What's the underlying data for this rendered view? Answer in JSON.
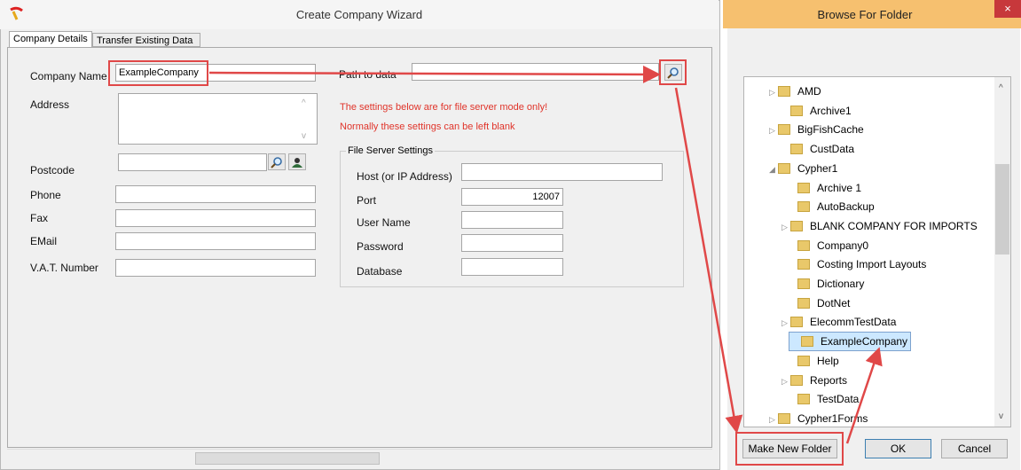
{
  "wizard": {
    "title": "Create Company Wizard",
    "tabs": [
      {
        "label": "Company Details",
        "active": true
      },
      {
        "label": "Transfer Existing Data",
        "active": false
      }
    ],
    "fields": {
      "company_name_label": "Company Name",
      "company_name_value": "ExampleCompany",
      "address_label": "Address",
      "postcode_label": "Postcode",
      "phone_label": "Phone",
      "fax_label": "Fax",
      "email_label": "EMail",
      "vat_label": "V.A.T. Number",
      "path_label": "Path to data"
    },
    "notes": {
      "line1": "The settings below are for file server mode only!",
      "line2": "Normally these settings can be left  blank"
    },
    "file_server": {
      "group_label": "File Server Settings",
      "host_label": "Host (or IP Address)",
      "port_label": "Port",
      "port_value": "12007",
      "user_label": "User Name",
      "password_label": "Password",
      "database_label": "Database"
    }
  },
  "browse": {
    "title": "Browse For Folder",
    "close_glyph": "×",
    "tree": [
      {
        "label": "AMD",
        "expander": "▷"
      },
      {
        "label": "Archive1",
        "expander": ""
      },
      {
        "label": "BigFishCache",
        "expander": "▷"
      },
      {
        "label": "CustData",
        "expander": ""
      },
      {
        "label": "Cypher1",
        "expander": "◢"
      },
      {
        "label": "Archive 1",
        "expander": ""
      },
      {
        "label": "AutoBackup",
        "expander": ""
      },
      {
        "label": "BLANK COMPANY FOR IMPORTS",
        "expander": "▷"
      },
      {
        "label": "Company0",
        "expander": ""
      },
      {
        "label": "Costing Import Layouts",
        "expander": ""
      },
      {
        "label": "Dictionary",
        "expander": ""
      },
      {
        "label": "DotNet",
        "expander": ""
      },
      {
        "label": "ElecommTestData",
        "expander": "▷"
      },
      {
        "label": "ExampleCompany",
        "expander": "",
        "selected": true
      },
      {
        "label": "Help",
        "expander": ""
      },
      {
        "label": "Reports",
        "expander": "▷"
      },
      {
        "label": "TestData",
        "expander": ""
      },
      {
        "label": "Cypher1Forms",
        "expander": "▷"
      }
    ],
    "buttons": {
      "new_folder": "Make New Folder",
      "ok": "OK",
      "cancel": "Cancel"
    }
  },
  "colors": {
    "annotation_red": "#e04848",
    "title_bar_accent": "#f6c06f",
    "warning_text": "#e0342a"
  },
  "icons": [
    "app-logo-icon",
    "search-icon",
    "lookup-person-icon",
    "folder-icon",
    "close-icon"
  ]
}
